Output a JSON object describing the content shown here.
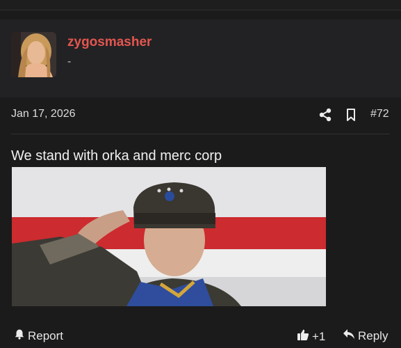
{
  "post": {
    "username": "zygosmasher",
    "user_title": "-",
    "date": "Jan 17, 2026",
    "post_number": "#72",
    "message": "We stand with orka and merc corp"
  },
  "actions": {
    "report_label": "Report",
    "like_label": "+1",
    "reply_label": "Reply"
  },
  "icons": {
    "share": "share-icon",
    "bookmark": "bookmark-icon",
    "report": "bell-icon",
    "like": "thumbs-up-icon",
    "reply": "reply-arrow-icon"
  },
  "colors": {
    "username": "#e4564f",
    "background": "#1b1b1c",
    "header_band": "#222224"
  }
}
